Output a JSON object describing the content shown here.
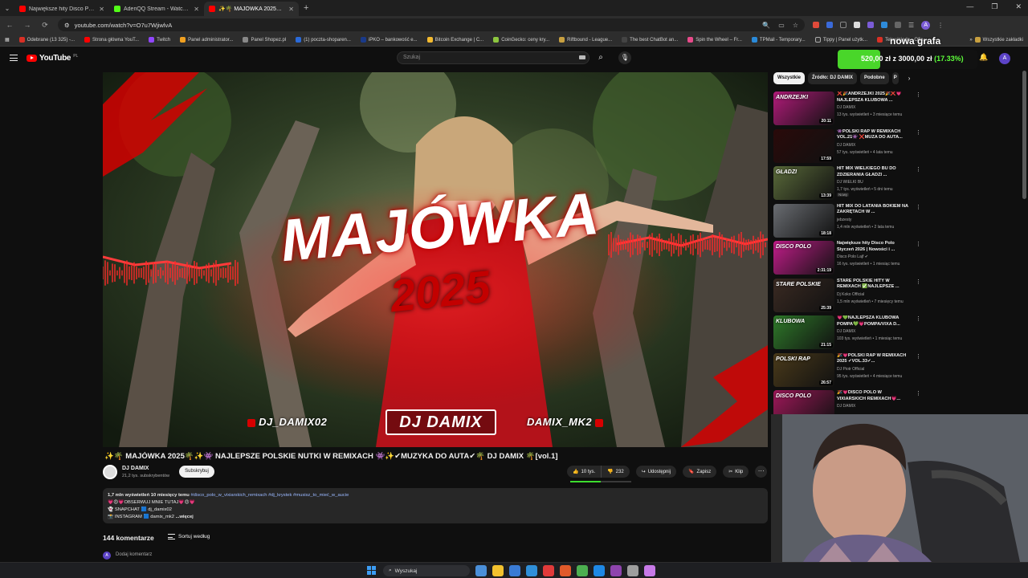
{
  "browser": {
    "tabs": [
      {
        "label": "Największe hity Disco Polo",
        "favicon_color": "#ff0000",
        "active": false
      },
      {
        "label": "AderiQQ Stream - Watch Live o",
        "favicon_color": "#53fc18",
        "active": false
      },
      {
        "label": "✨🌴 MAJÓWKA 2025🌴✨👾",
        "favicon_color": "#ff0000",
        "active": true
      }
    ],
    "new_tab": "+",
    "url": "youtube.com/watch?v=O7u7WjiwlvA",
    "bookmarks": [
      "Odebrane (13 325) -...",
      "Strona główna YouT...",
      "Twitch",
      "Panel administrator...",
      "Panel Shopez.pl",
      "(1) poczta-shoparen...",
      "iPKO – bankowość e...",
      "Bitcoin Exchange | C...",
      "CoinGecko: ceny kry...",
      "Riftbound - League...",
      "The best ChatBot an...",
      "Spin the Wheel – Fr...",
      "TPMail - Temporary...",
      "Tippy | Panel użytk...",
      "Telewizjada - Ofic..."
    ],
    "bookmarks_more": "»",
    "all_bookmarks": "Wszystkie zakładki",
    "profile_initial": "A"
  },
  "masthead": {
    "logo_text": "YouTube",
    "logo_country": "PL",
    "search_placeholder": "Szukaj",
    "avatar_initial": "A"
  },
  "stream_overlay": {
    "title": "nowa grafa",
    "amount_text": "520,00 zł z 3000,00 zł",
    "percent_text": "(17.33%)",
    "progress_fraction": 0.1733,
    "color": "#49d62a"
  },
  "thumbnail": {
    "title": "MAJÓWKA",
    "year": "2025",
    "left_handle": "DJ_DAMIX02",
    "center_logo": "DJ DAMIX",
    "right_handle": "DAMIX_MK2"
  },
  "video": {
    "title": "✨🌴 MAJÓWKA 2025🌴✨👾 NAJLEPSZE POLSKIE NUTKI W REMIXACH 👾✨✔MUZYKA DO AUTA✔🌴 DJ DAMIX 🌴[vol.1]",
    "channel": "DJ DAMIX",
    "subscribers": "21,2 tys. subskrybentów",
    "subscribe_label": "Subskrybuj",
    "likes": "10 tys.",
    "dislike_count": "232",
    "share_label": "Udostępnij",
    "save_label": "Zapisz",
    "clip_label": "Klip",
    "more_label": "···"
  },
  "description": {
    "meta": "1,7 mln wyświetleń  10 miesięcy temu",
    "tags": "#disco_polo_w_vixiarskich_remixach #dj_krystek #musisz_to_mieć_w_aucie",
    "line2": "💗😍💗OBSERWUJ MNIE TUTAJ💗😍💗",
    "line3": "👻 SNAPCHAT 🟦 dj_damix02",
    "line4": "📸 INSTAGRAM 🟦 damix_mk2",
    "more": "...więcej"
  },
  "comments": {
    "count": "144 komentarze",
    "sort_label": "Sortuj według",
    "add_placeholder": "Dodaj komentarz",
    "avatar_initial": "A"
  },
  "chips": [
    "Wszystkie",
    "Źródło: DJ DAMIX",
    "Podobne",
    "P"
  ],
  "recommendations": [
    {
      "title": "❌🎉ANDRZEJKI 2025🎉❌💗 NAJLEPSZA KLUBOWA ...",
      "channel": "DJ DAMIX",
      "meta": "13 tys. wyświetleń • 3 miesiące temu",
      "duration": "20:11",
      "thumb_text": "ANDRZEJKI",
      "thumb_color": "#b21b7a",
      "badge": ""
    },
    {
      "title": "👾POLSKI RAP W REMIXACH VOL.21👾 ❌MUZA DO AUTA...",
      "channel": "DJ DAMIX",
      "meta": "57 tys. wyświetleń • 4 lata temu",
      "duration": "17:59",
      "thumb_text": "",
      "thumb_color": "#2a0a0a",
      "badge": ""
    },
    {
      "title": "HIT MIX WIELKIEGO BU DO ZDZIERANIA GŁADZI ...",
      "channel": "DJ WIELKI BU",
      "meta": "1,7 tys. wyświetleń • 5 dni temu",
      "duration": "13:39",
      "thumb_text": "GŁADZI",
      "thumb_color": "#5a6a3a",
      "badge": "Nowy"
    },
    {
      "title": "HIT MIX DO LATANIA BOKIEM NA ZAKRĘTACH W ...",
      "channel": "jebzesty",
      "meta": "1,4 mln wyświetleń • 2 lata temu",
      "duration": "18:18",
      "thumb_text": "",
      "thumb_color": "#6a6d72",
      "badge": ""
    },
    {
      "title": "Największe hity Disco Polo Styczeń 2026 | Nowości i ...",
      "channel": "Disco Polo Lajf ✔",
      "meta": "16 tys. wyświetleń • 1 miesiąc temu",
      "duration": "2:31:19",
      "thumb_text": "DISCO POLO",
      "thumb_color": "#c21d8a",
      "badge": ""
    },
    {
      "title": "STARE POLSKIE HITY W REMIXACH ✅NAJLEPSZE ...",
      "channel": "Dj Koko Official",
      "meta": "1,5 mln wyświetleń • 7 miesięcy temu",
      "duration": "25:39",
      "thumb_text": "STARE POLSKIE",
      "thumb_color": "#3a2a22",
      "badge": ""
    },
    {
      "title": "💗💚NAJLEPSZA KLUBOWA POMPA💚💗POMPA/VIXA D...",
      "channel": "DJ DAMIX",
      "meta": "103 tys. wyświetleń • 1 miesiąc temu",
      "duration": "21:15",
      "thumb_text": "KLUBOWA",
      "thumb_color": "#2f7a2a",
      "badge": ""
    },
    {
      "title": "🎉💗POLSKI RAP W REMIXACH 2025 ✔VOL.33✔...",
      "channel": "DJ Piotr Official",
      "meta": "95 tys. wyświetleń • 4 miesiące temu",
      "duration": "26:57",
      "thumb_text": "POLSKI RAP",
      "thumb_color": "#4a3a1a",
      "badge": ""
    },
    {
      "title": "🎉💗DISCO POLO W VIXIARSKICH REMIXACH💗...",
      "channel": "DJ DAMIX",
      "meta": "",
      "duration": "",
      "thumb_text": "DISCO POLO",
      "thumb_color": "#a0185a",
      "badge": ""
    }
  ],
  "taskbar": {
    "search_label": "Wyszukaj",
    "apps": [
      "#4a8fd9",
      "#f2c12e",
      "#3a7bd5",
      "#2f8fd9",
      "#e03a3a",
      "#e05a2a",
      "#4caf50",
      "#1e88e5",
      "#8e44ad",
      "#9e9e9e",
      "#c87ae8"
    ]
  },
  "colors": {
    "accent_red": "#ff0000",
    "yt_bg": "#0f0f0f"
  }
}
